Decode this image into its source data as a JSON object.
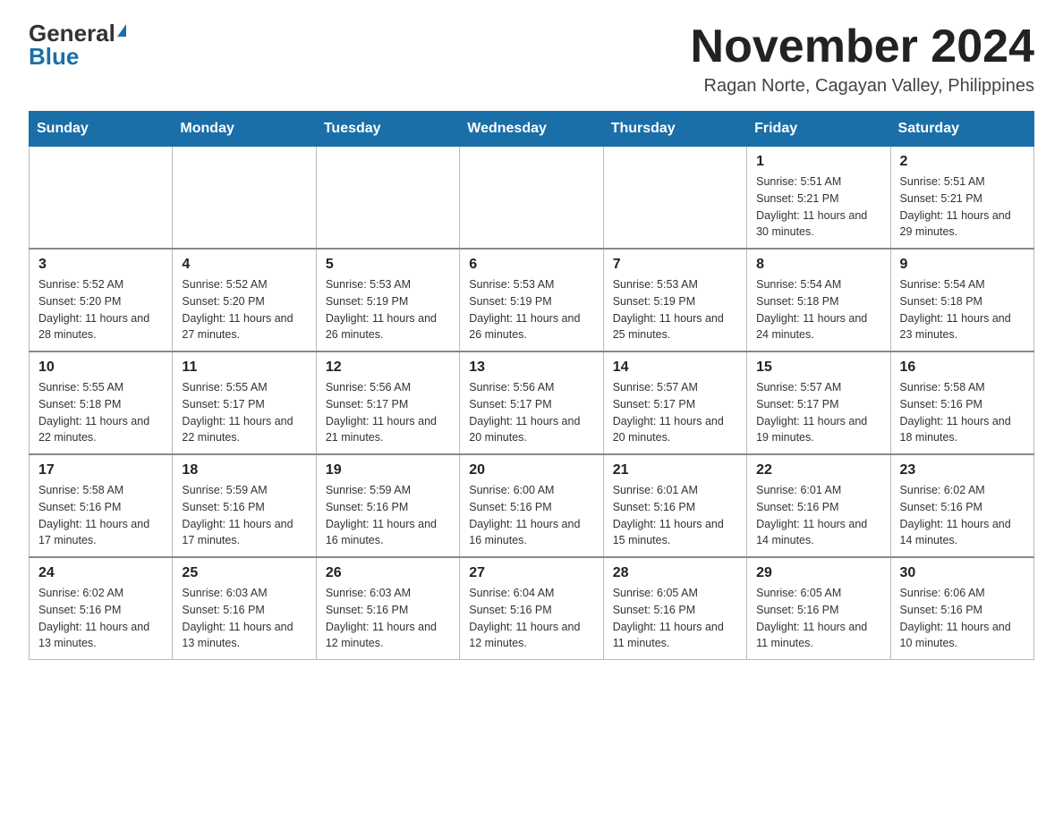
{
  "header": {
    "logo_general": "General",
    "logo_blue": "Blue",
    "month_title": "November 2024",
    "location": "Ragan Norte, Cagayan Valley, Philippines"
  },
  "weekdays": [
    "Sunday",
    "Monday",
    "Tuesday",
    "Wednesday",
    "Thursday",
    "Friday",
    "Saturday"
  ],
  "weeks": [
    [
      {
        "day": "",
        "info": ""
      },
      {
        "day": "",
        "info": ""
      },
      {
        "day": "",
        "info": ""
      },
      {
        "day": "",
        "info": ""
      },
      {
        "day": "",
        "info": ""
      },
      {
        "day": "1",
        "info": "Sunrise: 5:51 AM\nSunset: 5:21 PM\nDaylight: 11 hours and 30 minutes."
      },
      {
        "day": "2",
        "info": "Sunrise: 5:51 AM\nSunset: 5:21 PM\nDaylight: 11 hours and 29 minutes."
      }
    ],
    [
      {
        "day": "3",
        "info": "Sunrise: 5:52 AM\nSunset: 5:20 PM\nDaylight: 11 hours and 28 minutes."
      },
      {
        "day": "4",
        "info": "Sunrise: 5:52 AM\nSunset: 5:20 PM\nDaylight: 11 hours and 27 minutes."
      },
      {
        "day": "5",
        "info": "Sunrise: 5:53 AM\nSunset: 5:19 PM\nDaylight: 11 hours and 26 minutes."
      },
      {
        "day": "6",
        "info": "Sunrise: 5:53 AM\nSunset: 5:19 PM\nDaylight: 11 hours and 26 minutes."
      },
      {
        "day": "7",
        "info": "Sunrise: 5:53 AM\nSunset: 5:19 PM\nDaylight: 11 hours and 25 minutes."
      },
      {
        "day": "8",
        "info": "Sunrise: 5:54 AM\nSunset: 5:18 PM\nDaylight: 11 hours and 24 minutes."
      },
      {
        "day": "9",
        "info": "Sunrise: 5:54 AM\nSunset: 5:18 PM\nDaylight: 11 hours and 23 minutes."
      }
    ],
    [
      {
        "day": "10",
        "info": "Sunrise: 5:55 AM\nSunset: 5:18 PM\nDaylight: 11 hours and 22 minutes."
      },
      {
        "day": "11",
        "info": "Sunrise: 5:55 AM\nSunset: 5:17 PM\nDaylight: 11 hours and 22 minutes."
      },
      {
        "day": "12",
        "info": "Sunrise: 5:56 AM\nSunset: 5:17 PM\nDaylight: 11 hours and 21 minutes."
      },
      {
        "day": "13",
        "info": "Sunrise: 5:56 AM\nSunset: 5:17 PM\nDaylight: 11 hours and 20 minutes."
      },
      {
        "day": "14",
        "info": "Sunrise: 5:57 AM\nSunset: 5:17 PM\nDaylight: 11 hours and 20 minutes."
      },
      {
        "day": "15",
        "info": "Sunrise: 5:57 AM\nSunset: 5:17 PM\nDaylight: 11 hours and 19 minutes."
      },
      {
        "day": "16",
        "info": "Sunrise: 5:58 AM\nSunset: 5:16 PM\nDaylight: 11 hours and 18 minutes."
      }
    ],
    [
      {
        "day": "17",
        "info": "Sunrise: 5:58 AM\nSunset: 5:16 PM\nDaylight: 11 hours and 17 minutes."
      },
      {
        "day": "18",
        "info": "Sunrise: 5:59 AM\nSunset: 5:16 PM\nDaylight: 11 hours and 17 minutes."
      },
      {
        "day": "19",
        "info": "Sunrise: 5:59 AM\nSunset: 5:16 PM\nDaylight: 11 hours and 16 minutes."
      },
      {
        "day": "20",
        "info": "Sunrise: 6:00 AM\nSunset: 5:16 PM\nDaylight: 11 hours and 16 minutes."
      },
      {
        "day": "21",
        "info": "Sunrise: 6:01 AM\nSunset: 5:16 PM\nDaylight: 11 hours and 15 minutes."
      },
      {
        "day": "22",
        "info": "Sunrise: 6:01 AM\nSunset: 5:16 PM\nDaylight: 11 hours and 14 minutes."
      },
      {
        "day": "23",
        "info": "Sunrise: 6:02 AM\nSunset: 5:16 PM\nDaylight: 11 hours and 14 minutes."
      }
    ],
    [
      {
        "day": "24",
        "info": "Sunrise: 6:02 AM\nSunset: 5:16 PM\nDaylight: 11 hours and 13 minutes."
      },
      {
        "day": "25",
        "info": "Sunrise: 6:03 AM\nSunset: 5:16 PM\nDaylight: 11 hours and 13 minutes."
      },
      {
        "day": "26",
        "info": "Sunrise: 6:03 AM\nSunset: 5:16 PM\nDaylight: 11 hours and 12 minutes."
      },
      {
        "day": "27",
        "info": "Sunrise: 6:04 AM\nSunset: 5:16 PM\nDaylight: 11 hours and 12 minutes."
      },
      {
        "day": "28",
        "info": "Sunrise: 6:05 AM\nSunset: 5:16 PM\nDaylight: 11 hours and 11 minutes."
      },
      {
        "day": "29",
        "info": "Sunrise: 6:05 AM\nSunset: 5:16 PM\nDaylight: 11 hours and 11 minutes."
      },
      {
        "day": "30",
        "info": "Sunrise: 6:06 AM\nSunset: 5:16 PM\nDaylight: 11 hours and 10 minutes."
      }
    ]
  ]
}
